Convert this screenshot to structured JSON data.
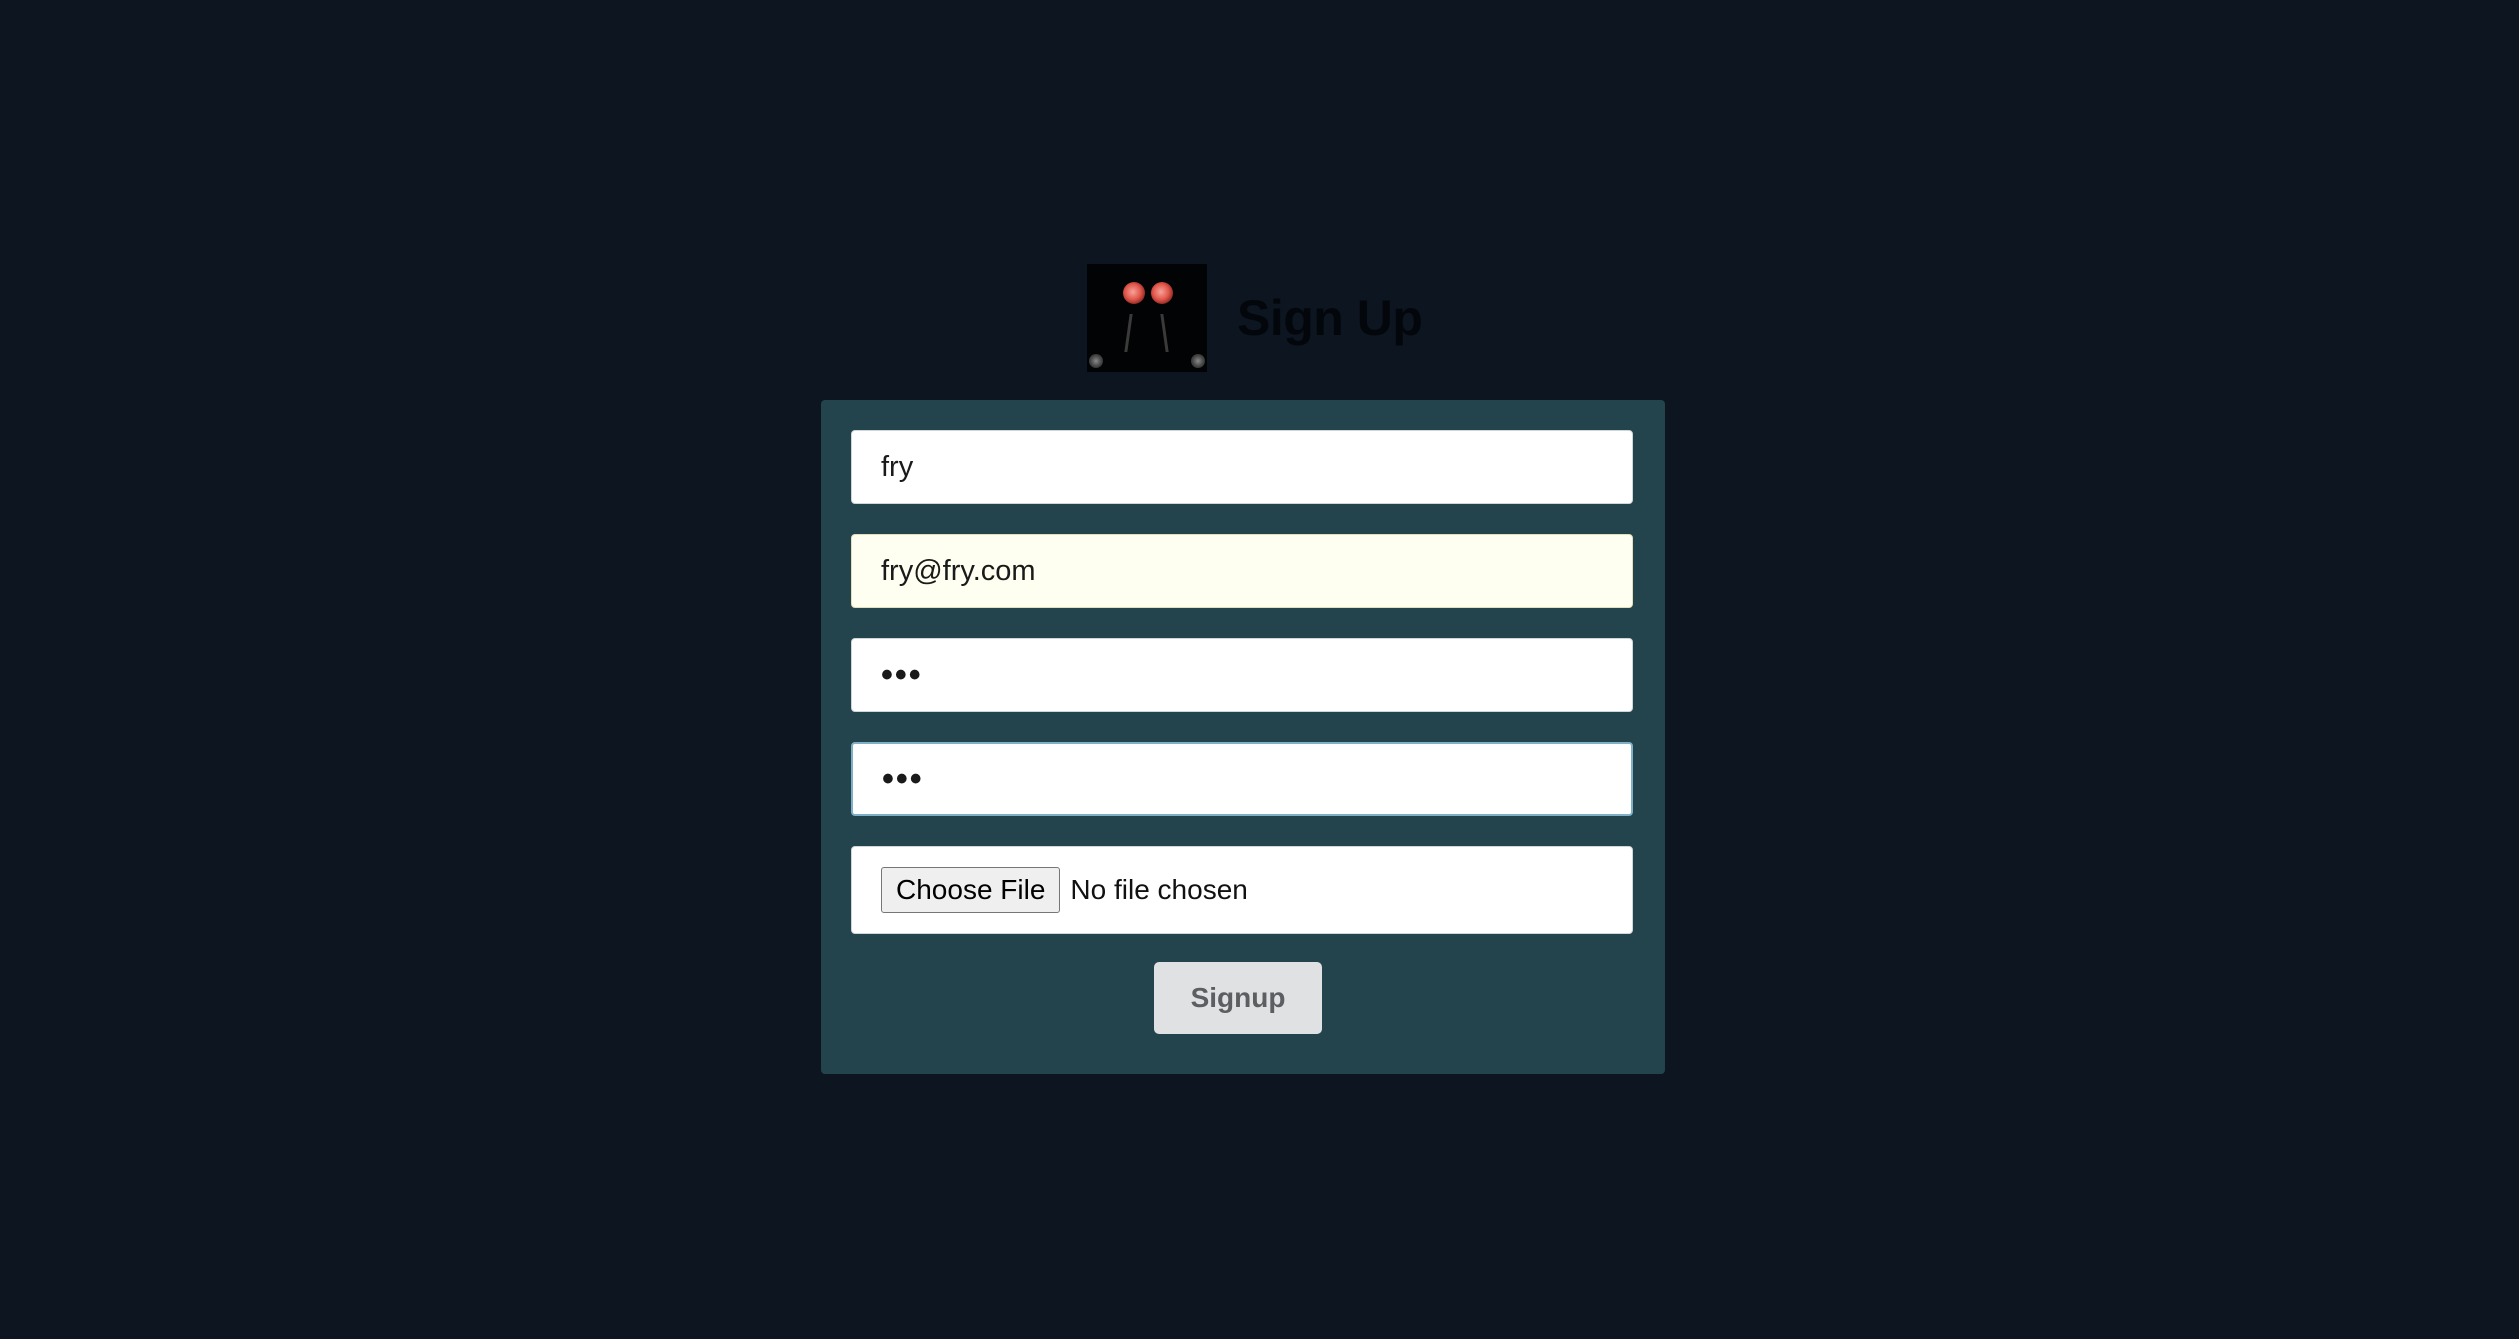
{
  "header": {
    "logo_icon": "glowing-eyes-logo-icon",
    "title": "Sign Up"
  },
  "form": {
    "username_value": "fry",
    "email_value": "fry@fry.com",
    "password_value": "•••",
    "confirm_password_value": "•••",
    "file_button_label": "Choose File",
    "file_status": "No file chosen",
    "submit_label": "Signup"
  },
  "colors": {
    "background": "#0c1520",
    "panel": "#23444d",
    "autofill_background": "#fefff0",
    "focus_border": "#7fb0c6"
  }
}
